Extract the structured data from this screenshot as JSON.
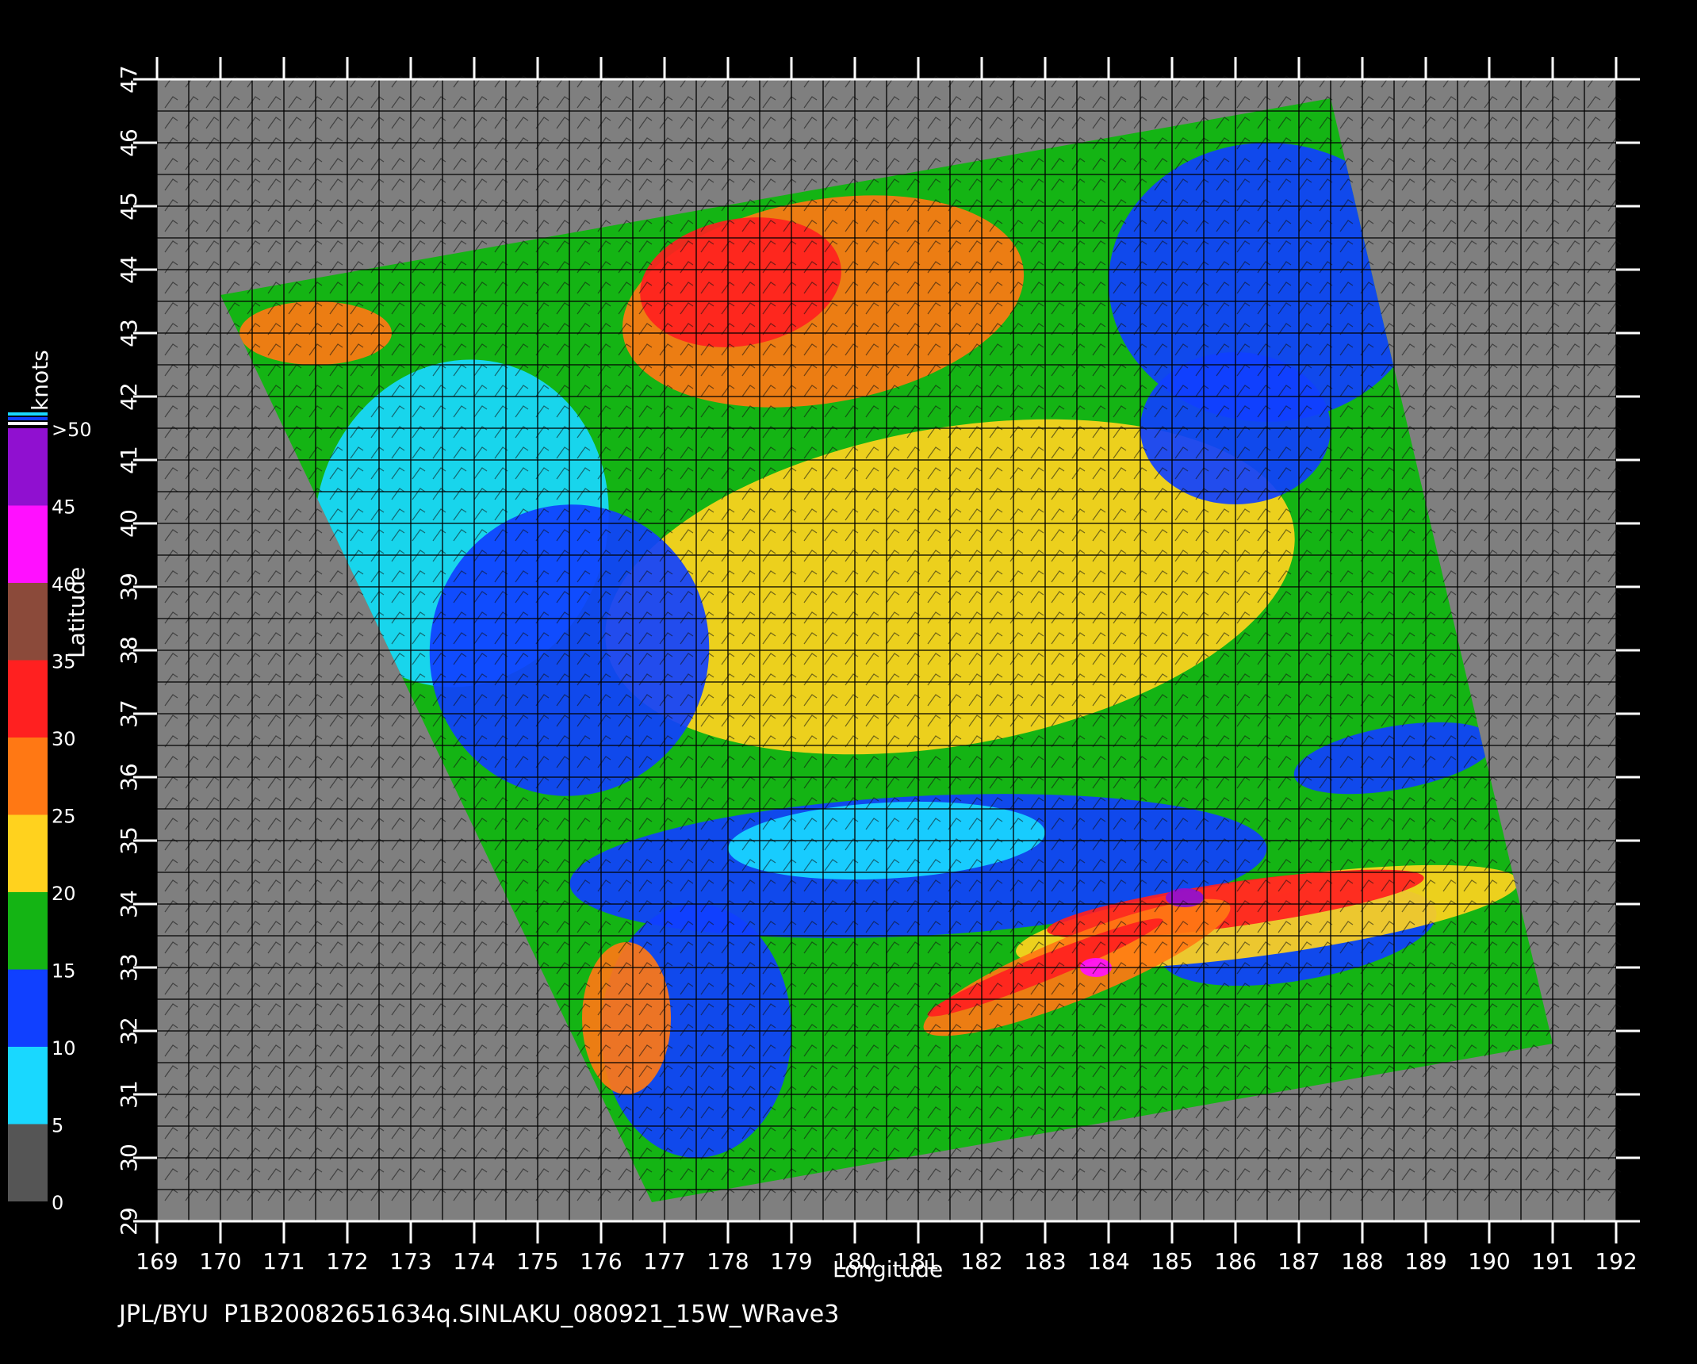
{
  "map": {
    "lon_min": 169,
    "lon_max": 192,
    "lat_min": 29,
    "lat_max": 47,
    "xlabel": "Longitude",
    "ylabel": "Latitude",
    "lon_ticks": [
      "169",
      "170",
      "171",
      "172",
      "173",
      "174",
      "175",
      "176",
      "177",
      "178",
      "179",
      "180",
      "181",
      "182",
      "183",
      "184",
      "185",
      "186",
      "187",
      "188",
      "189",
      "190",
      "191",
      "192"
    ],
    "lat_ticks": [
      "29",
      "30",
      "31",
      "32",
      "33",
      "34",
      "35",
      "36",
      "37",
      "38",
      "39",
      "40",
      "41",
      "42",
      "43",
      "44",
      "45",
      "46",
      "47"
    ],
    "background_color": "#7f7f7f",
    "grid_color": "#000000"
  },
  "colorbar": {
    "unit": "knots",
    "labels": [
      ">50",
      "45",
      "40",
      "35",
      "30",
      "25",
      "20",
      "15",
      "10",
      "5",
      "0"
    ],
    "stops": [
      {
        "from": 0,
        "to": 5,
        "color": "#555555"
      },
      {
        "from": 5,
        "to": 10,
        "color": "#19d8ff"
      },
      {
        "from": 10,
        "to": 15,
        "color": "#1040ff"
      },
      {
        "from": 15,
        "to": 20,
        "color": "#14b414"
      },
      {
        "from": 20,
        "to": 25,
        "color": "#ffd21e"
      },
      {
        "from": 25,
        "to": 30,
        "color": "#ff7814"
      },
      {
        "from": 30,
        "to": 35,
        "color": "#ff2020"
      },
      {
        "from": 35,
        "to": 40,
        "color": "#8b4a3a"
      },
      {
        "from": 40,
        "to": 45,
        "color": "#ff10ff"
      },
      {
        "from": 45,
        "to": 50,
        "color": "#9010d0"
      }
    ]
  },
  "footer": "JPL/BYU  P1B20082651634q.SINLAKU_080921_15W_WRave3"
}
